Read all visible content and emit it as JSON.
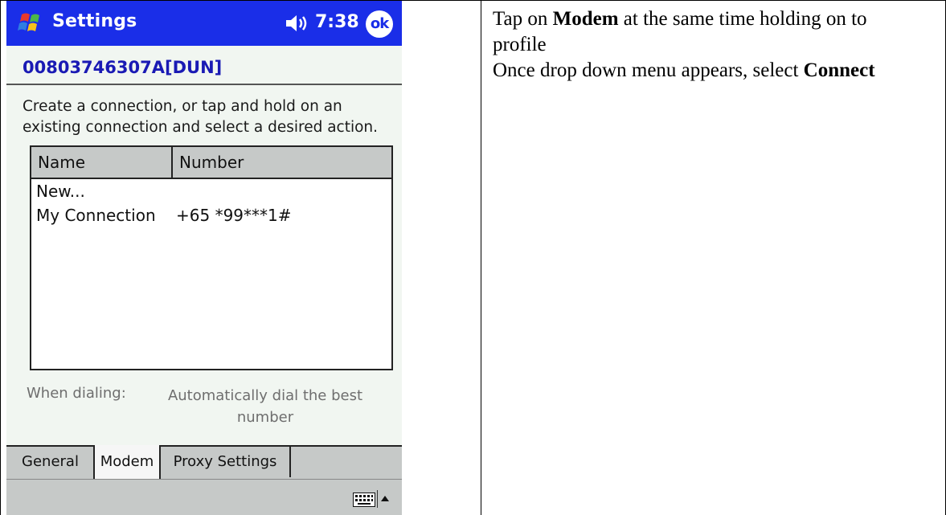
{
  "titlebar": {
    "title": "Settings",
    "time": "7:38",
    "ok_label": "ok",
    "start_icon": "windows-flag-icon",
    "speaker_icon": "speaker-icon"
  },
  "profile": {
    "title": "00803746307A[DUN]"
  },
  "instructions": "Create a connection, or tap and hold on an existing connection and select a desired action.",
  "connections": {
    "columns": [
      "Name",
      "Number"
    ],
    "rows": [
      {
        "name": "New...",
        "number": ""
      },
      {
        "name": "My Connection",
        "number": "+65 *99***1#"
      }
    ]
  },
  "dialing": {
    "label": "When dialing:",
    "value": "Automatically dial the best number"
  },
  "tabs": [
    "General",
    "Modem",
    "Proxy Settings"
  ],
  "active_tab": "Modem",
  "command_bar": {
    "keyboard_icon": "keyboard-icon",
    "sip_arrow_icon": "up-arrow-icon"
  },
  "note": {
    "line1_pre": "Tap on ",
    "line1_bold": "Modem",
    "line1_post": " at the same time holding on to profile",
    "line2": "Once drop down menu appears, select ",
    "line2_bold": "Connect"
  },
  "colors": {
    "titlebar": "#1a2ee8",
    "profile_title": "#1a1ab4",
    "screen_bg": "#f1f6f1",
    "bar_gray": "#c6c9c8"
  }
}
